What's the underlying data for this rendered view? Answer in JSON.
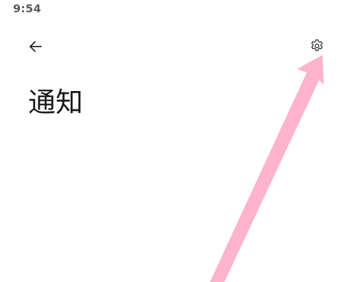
{
  "status_bar": {
    "time": "9:54"
  },
  "header": {
    "back_icon": "arrow-left-icon",
    "settings_icon": "gear-icon"
  },
  "page": {
    "title": "通知"
  },
  "annotation": {
    "arrow_color": "#ffb3cc"
  },
  "colors": {
    "background": "#ffffff",
    "text": "#1a1a1a",
    "status_text": "#5a5a5a"
  }
}
